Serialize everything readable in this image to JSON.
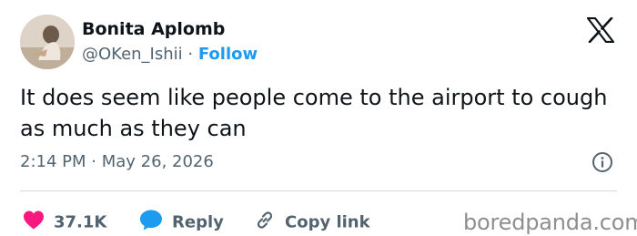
{
  "author": {
    "name": "Bonita Aplomb",
    "handle": "@OKen_Ishii",
    "separator": "·",
    "follow_label": "Follow"
  },
  "tweet": {
    "text": "It does seem like people come to the airport to cough as much as they can",
    "time": "2:14 PM",
    "date_separator": "·",
    "date": "May 26, 2026"
  },
  "actions": {
    "likes_count": "37.1K",
    "reply_label": "Reply",
    "copy_link_label": "Copy link"
  },
  "watermark": "boredpanda.com",
  "icons": {
    "x_logo": "x-logo-icon",
    "info": "info-icon",
    "heart": "heart-icon",
    "reply": "speech-bubble-icon",
    "copy_link": "link-icon"
  },
  "colors": {
    "text": "#0f1419",
    "secondary": "#536471",
    "follow": "#1d9bf0",
    "heart": "#f91880",
    "reply": "#1d9bf0",
    "divider": "#cfd9de"
  }
}
